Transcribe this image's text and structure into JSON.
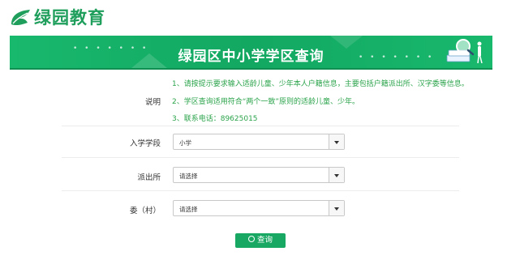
{
  "header": {
    "logo_text": "绿园教育"
  },
  "banner": {
    "title": "绿园区中小学学区查询"
  },
  "notes": {
    "label": "说明",
    "lines": [
      "1、请按提示要求输入适龄儿童、少年本人户籍信息，主要包括户籍派出所、汉字委等信息。",
      "2、学区查询适用符合“两个一致”原则的适龄儿童、少年。",
      "3、联系电话：89625015"
    ]
  },
  "form": {
    "stage": {
      "label": "入学学段",
      "value": "小学"
    },
    "police": {
      "label": "派出所",
      "value": "请选择"
    },
    "committee": {
      "label": "委（村）",
      "value": "请选择"
    }
  },
  "actions": {
    "query_label": "查询"
  },
  "colors": {
    "brand_green": "#19a863",
    "note_green": "#2aa34a"
  }
}
